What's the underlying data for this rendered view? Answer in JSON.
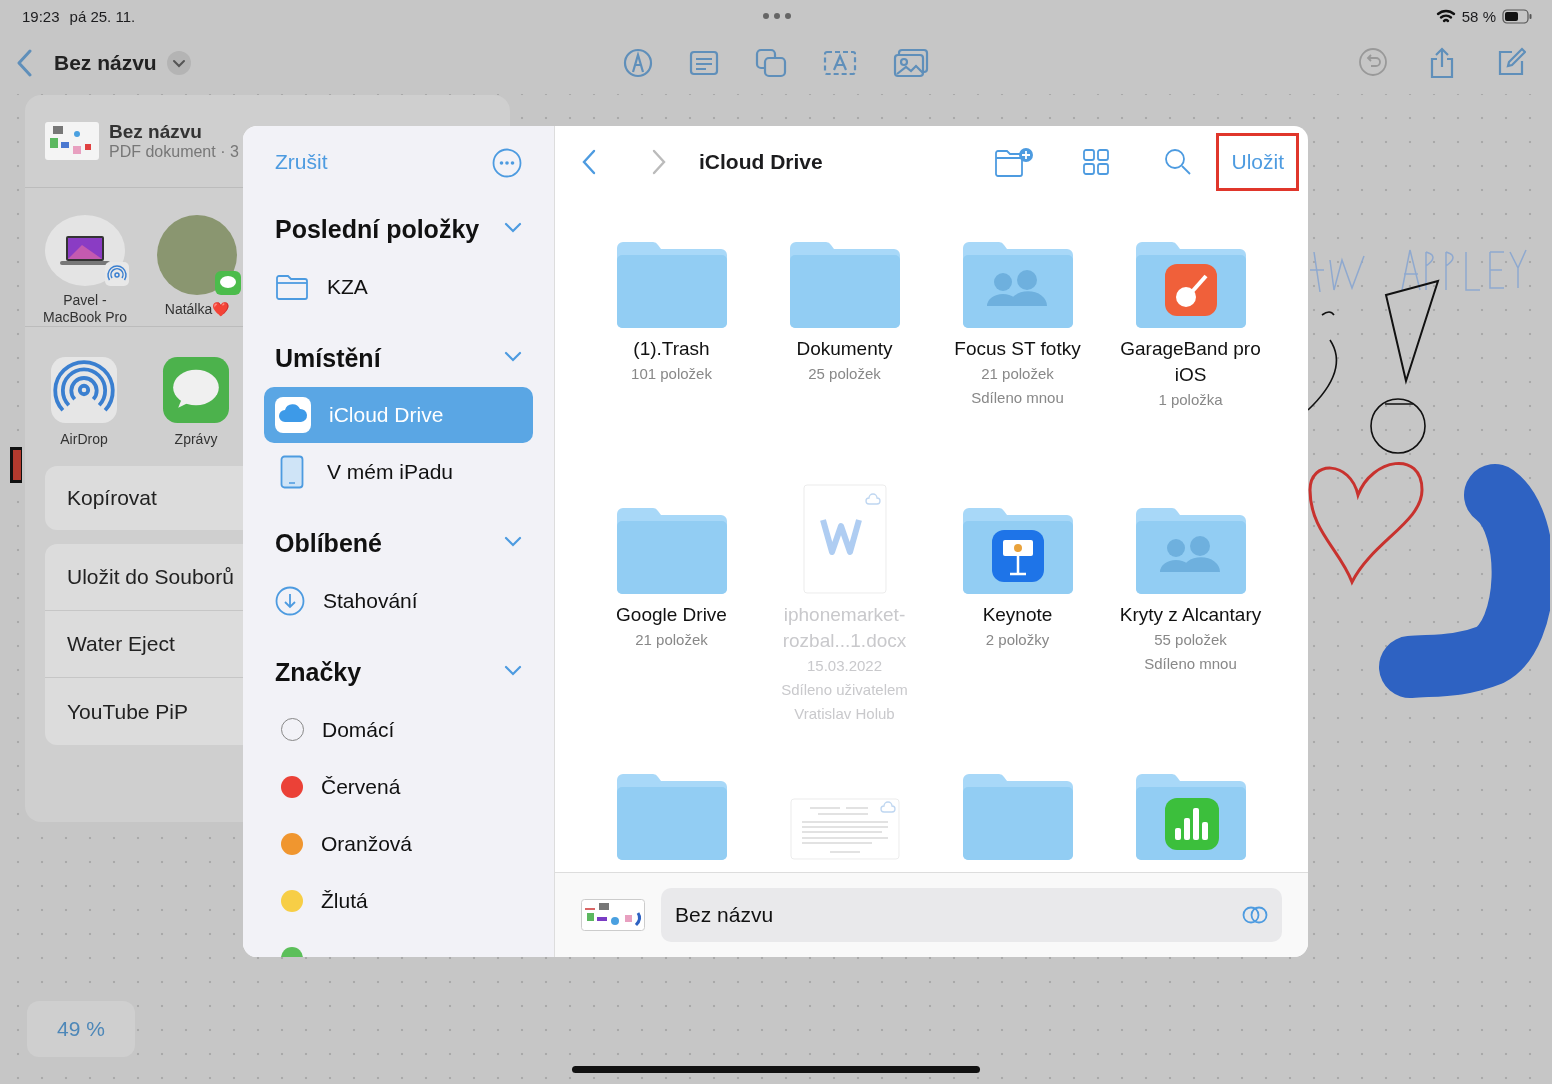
{
  "status_bar": {
    "time": "19:23",
    "date": "pá 25. 11.",
    "battery": "58 %"
  },
  "toolbar": {
    "title": "Bez názvu",
    "undo_disabled": true
  },
  "share_sheet": {
    "document": {
      "title": "Bez názvu",
      "subtitle": "PDF dokument · 3"
    },
    "people": [
      {
        "name": "Pavel - MacBook Pro",
        "kind": "device"
      },
      {
        "name": "Natálka❤️",
        "kind": "contact"
      }
    ],
    "apps": [
      {
        "name": "AirDrop",
        "kind": "airdrop"
      },
      {
        "name": "Zprávy",
        "kind": "messages"
      }
    ],
    "action_groups": [
      [
        "Kopírovat"
      ],
      [
        "Uložit do Souborů",
        "Water Eject",
        "YouTube PiP"
      ]
    ]
  },
  "dialog": {
    "cancel": "Zrušit",
    "sections": [
      {
        "title": "Poslední položky",
        "expanded": true,
        "items": [
          {
            "label": "KZA",
            "kind": "folder",
            "selected": false
          }
        ]
      },
      {
        "title": "Umístění",
        "expanded": true,
        "items": [
          {
            "label": "iCloud Drive",
            "kind": "icloud",
            "selected": true
          },
          {
            "label": "V mém iPadu",
            "kind": "ipad",
            "selected": false
          }
        ]
      },
      {
        "title": "Oblíbené",
        "expanded": true,
        "items": [
          {
            "label": "Stahování",
            "kind": "download",
            "selected": false
          }
        ]
      },
      {
        "title": "Značky",
        "expanded": true,
        "items": [
          {
            "label": "Domácí",
            "kind": "outline",
            "selected": false
          },
          {
            "label": "Červená",
            "kind": "tag",
            "color": "#eb4137",
            "selected": false
          },
          {
            "label": "Oranžová",
            "kind": "tag",
            "color": "#f0962f",
            "selected": false
          },
          {
            "label": "Žlutá",
            "kind": "tag",
            "color": "#f7ce46",
            "selected": false
          },
          {
            "kind": "tag",
            "color": "#5cbf5a",
            "selected": false
          }
        ]
      }
    ],
    "location": {
      "title": "iCloud Drive",
      "save": "Uložit",
      "save_highlighted": true
    },
    "files": [
      {
        "name": "(1).Trash",
        "details": [
          "101 položek"
        ],
        "kind": "folder",
        "disabled": false
      },
      {
        "name": "Dokumenty",
        "details": [
          "25 položek"
        ],
        "kind": "folder",
        "disabled": false
      },
      {
        "name": "Focus ST fotky",
        "details": [
          "21 položek",
          "Sdíleno mnou"
        ],
        "kind": "shared",
        "disabled": false
      },
      {
        "name": "GarageBand pro iOS",
        "details": [
          "1 položka"
        ],
        "kind": "garageband",
        "disabled": false
      },
      {
        "name": "Google Drive",
        "details": [
          "21 položek"
        ],
        "kind": "folder",
        "disabled": false
      },
      {
        "name": "iphonemarket-rozbal...1.docx",
        "details": [
          "15.03.2022",
          "Sdíleno uživatelem Vratislav Holub"
        ],
        "kind": "word",
        "disabled": true
      },
      {
        "name": "Keynote",
        "details": [
          "2 položky"
        ],
        "kind": "keynote",
        "disabled": false
      },
      {
        "name": "Kryty z Alcantary",
        "details": [
          "55 položek",
          "Sdíleno mnou"
        ],
        "kind": "shared",
        "disabled": false
      },
      {
        "kind": "folder",
        "disabled": false
      },
      {
        "kind": "preview",
        "disabled": true
      },
      {
        "kind": "folder",
        "disabled": false
      },
      {
        "kind": "numbers",
        "disabled": false
      }
    ],
    "save_bar": {
      "filename": "Bez názvu"
    }
  },
  "zoom": "49 %"
}
